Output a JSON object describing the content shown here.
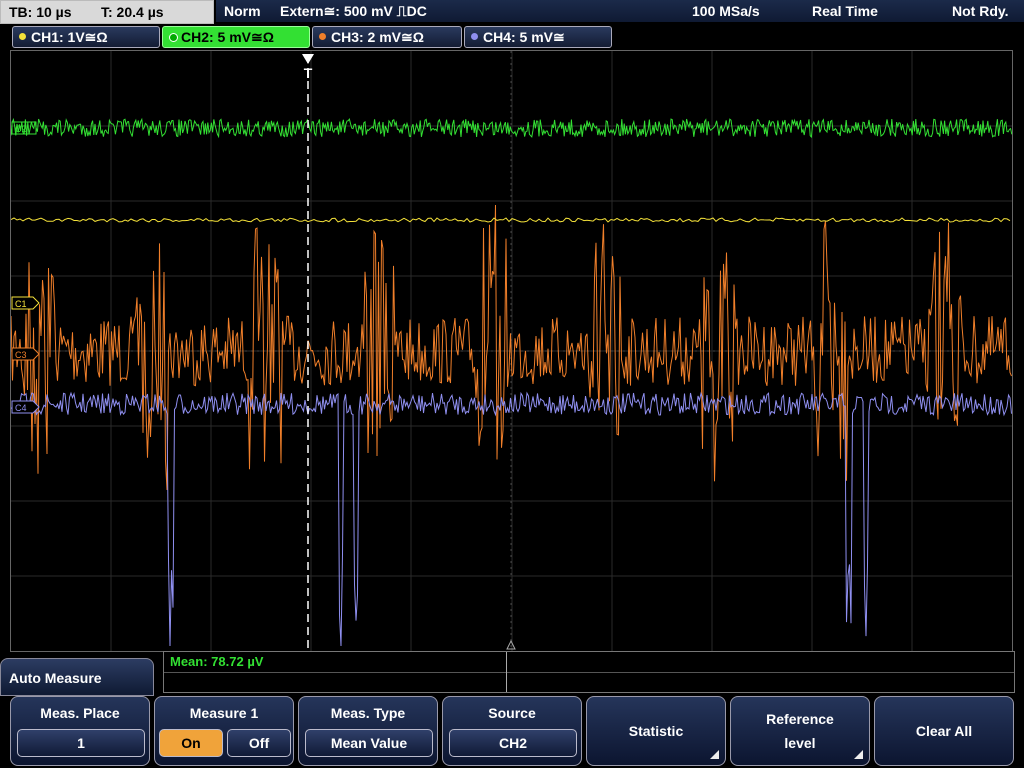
{
  "status": {
    "timebase": "TB: 10 µs",
    "trigger_time": "T: 20.4 µs",
    "mode": "Norm",
    "trigger_source": "Extern≅: 500 mV ⎍DC",
    "sample_rate": "100 MSa/s",
    "acquisition": "Real Time",
    "state": "Not Rdy."
  },
  "channels": [
    {
      "label": "CH1: 1V≅Ω",
      "color": "#f5e23a",
      "active": false
    },
    {
      "label": "CH2: 5 mV≅Ω",
      "color": "#33e033",
      "active": true
    },
    {
      "label": "CH3: 2 mV≅Ω",
      "color": "#f07f2a",
      "active": false
    },
    {
      "label": "CH4: 5 mV≅",
      "color": "#8f8ff0",
      "active": false
    }
  ],
  "markers": {
    "trigger": "T",
    "ch2": "C2",
    "ch1": "C1",
    "ch3": "C3",
    "ch4": "C4"
  },
  "measurement": {
    "readout": "Mean: 78.72 µV"
  },
  "menu": {
    "title": "Auto Measure",
    "meas_place": {
      "label": "Meas. Place",
      "value": "1"
    },
    "measure1": {
      "label": "Measure 1",
      "on": "On",
      "off": "Off",
      "state": "on"
    },
    "meas_type": {
      "label": "Meas. Type",
      "value": "Mean Value"
    },
    "source": {
      "label": "Source",
      "value": "CH2"
    },
    "statistic": {
      "label": "Statistic"
    },
    "reference": {
      "label_line1": "Reference",
      "label_line2": "level"
    },
    "clear_all": {
      "label": "Clear All"
    }
  }
}
